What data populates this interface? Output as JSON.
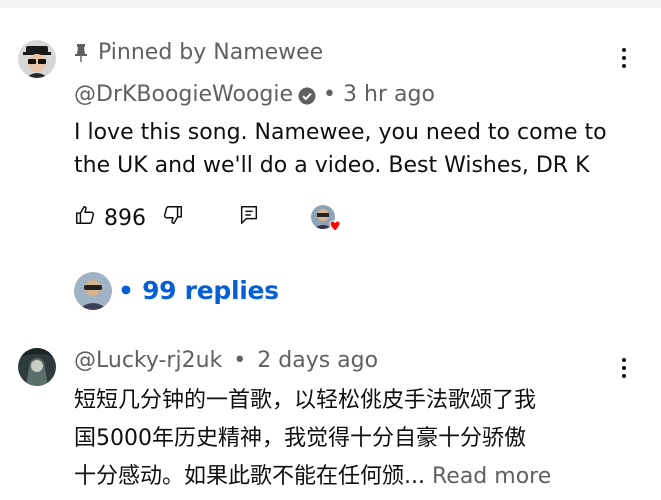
{
  "pinned_comment": {
    "pinned_label": "Pinned by Namewee",
    "author": "@DrKBoogieWoogie",
    "separator": "•",
    "time": "3 hr ago",
    "text_line1": "I love this song. Namewee, you need to come to",
    "text_line2": "the UK and we'll do a video. Best Wishes, DR K",
    "like_count": "896",
    "replies_label": "• 99 replies"
  },
  "second_comment": {
    "author": "@Lucky-rj2uk",
    "separator": "•",
    "time": "2 days ago",
    "text_line1": "短短几分钟的一首歌，以轻松佻皮手法歌颂了我",
    "text_line2": "国5000年历史精神，我觉得十分自豪十分骄傲",
    "text_line3": "十分感动。如果此歌不能在任何颁...",
    "read_more": "Read more"
  },
  "icons": {
    "pin": "pin-icon",
    "verified": "verified-check-icon",
    "more": "more-vert-icon",
    "like": "thumb-up-icon",
    "dislike": "thumb-down-icon",
    "reply": "reply-comment-icon",
    "creator_heart": "creator-heart-icon"
  },
  "colors": {
    "link_blue": "#065fd4",
    "secondary_text": "#606060",
    "primary_text": "#0f0f0f",
    "heart_red": "#ff0000"
  }
}
